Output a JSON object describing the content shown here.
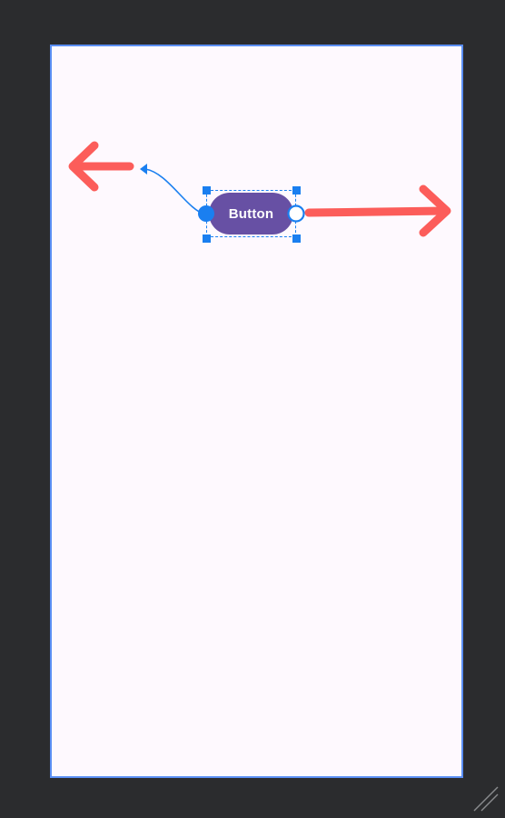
{
  "canvas": {
    "background_color": "#fef9fe",
    "border_color": "#5b8ff4"
  },
  "button": {
    "label": "Button",
    "fill_color": "#6750a4",
    "text_color": "#ffffff"
  },
  "selection": {
    "color": "#1a7ff0"
  },
  "hints": {
    "arrow_color": "#fc5d5a",
    "left_arrow_icon": "arrow-left-icon",
    "right_arrow_icon": "arrow-right-icon"
  },
  "app": {
    "background_color": "#2b2c2e",
    "resize_icon": "resize-grip-icon"
  }
}
